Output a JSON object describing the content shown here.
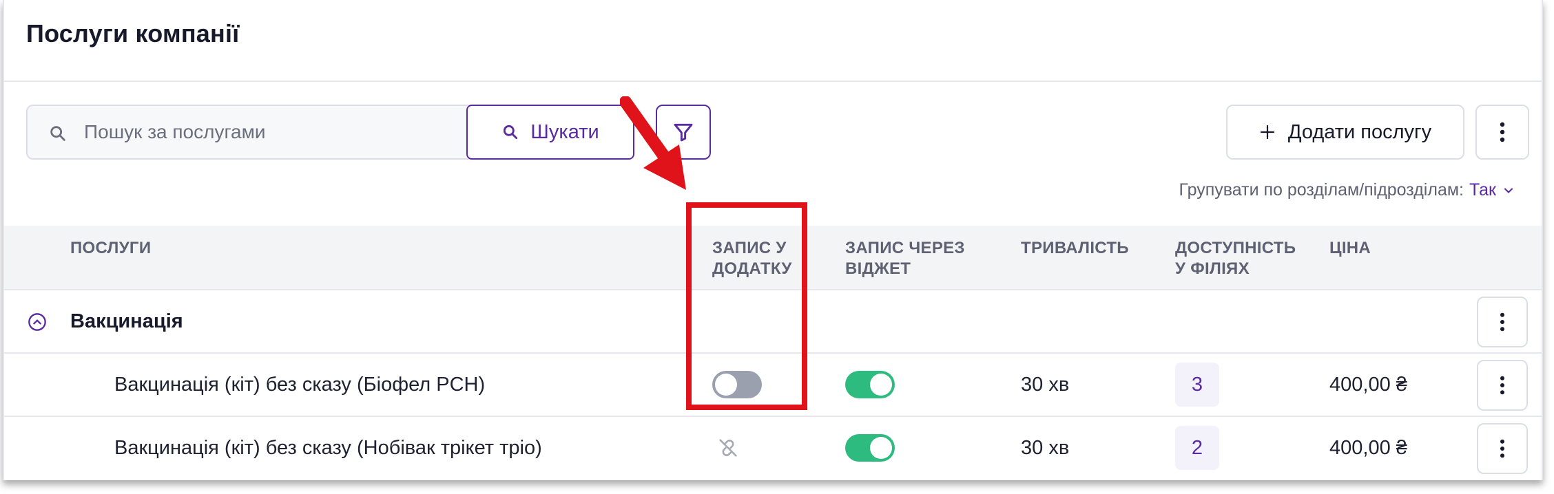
{
  "page": {
    "title": "Послуги компанії"
  },
  "search": {
    "placeholder": "Пошук за послугами",
    "value": "",
    "button_label": "Шукати"
  },
  "toolbar": {
    "add_label": "Додати послугу"
  },
  "grouping": {
    "label": "Групувати по розділам/підрозділам:",
    "value": "Так"
  },
  "table": {
    "headers": {
      "services": "Послуги",
      "app_booking_1": "Запис у",
      "app_booking_2": "додатку",
      "widget_booking_1": "Запис через",
      "widget_booking_2": "віджет",
      "duration": "Тривалість",
      "availability_1": "Доступність",
      "availability_2": "у філіях",
      "price": "Ціна"
    },
    "group": {
      "name": "Вакцинація",
      "expanded": true
    },
    "rows": [
      {
        "name": "Вакцинація (кіт) без сказу (Біофел PCH)",
        "app_booking": "off",
        "widget_booking": "on",
        "duration": "30 хв",
        "branches": "3",
        "price": "400,00 ₴"
      },
      {
        "name": "Вакцинація (кіт) без сказу (Нобівак трікет тріо)",
        "app_booking": "unlinked",
        "widget_booking": "on",
        "duration": "30 хв",
        "branches": "2",
        "price": "400,00 ₴"
      }
    ]
  },
  "colors": {
    "accent": "#5a2aa0",
    "toggle_on": "#2ebb7f",
    "toggle_off": "#9aa0ad",
    "annotation": "#e0121a"
  },
  "icons": {
    "search": "search-icon",
    "filter": "filter-icon",
    "add": "plus-icon",
    "more": "more-vertical-icon",
    "collapse": "chevron-up-circle-icon",
    "unlinked": "unlink-icon",
    "dropdown": "chevron-down-icon"
  }
}
